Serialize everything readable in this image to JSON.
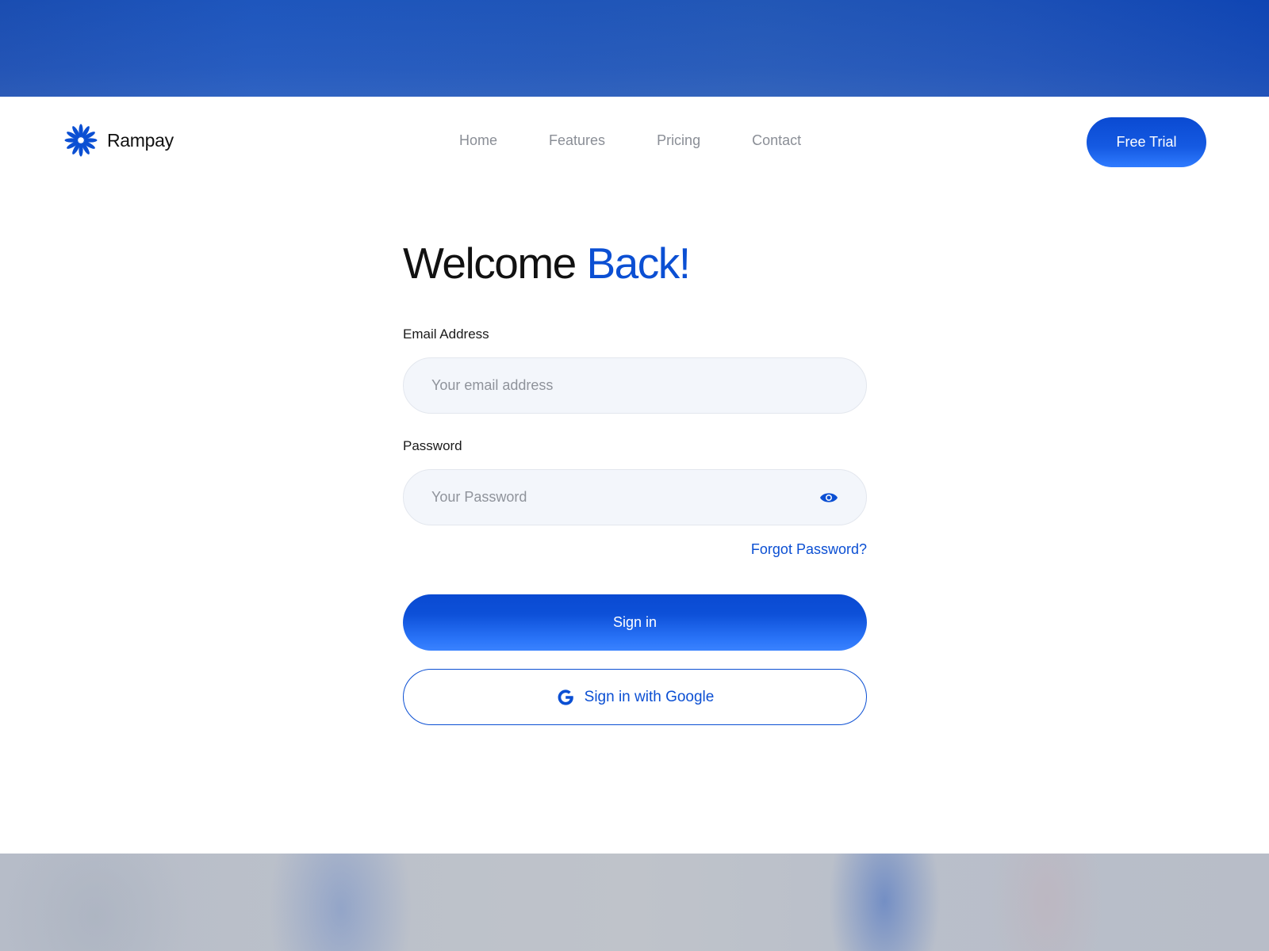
{
  "brand": {
    "name": "Rampay",
    "logo_icon": "asterisk-flower-icon",
    "color": "#0b4fd3"
  },
  "nav": {
    "items": [
      "Home",
      "Features",
      "Pricing",
      "Contact"
    ]
  },
  "header": {
    "cta_label": "Free Trial"
  },
  "form": {
    "title_main": "Welcome",
    "title_accent": "Back!",
    "email_label": "Email Address",
    "email_placeholder": "Your email address",
    "password_label": "Password",
    "password_placeholder": "Your Password",
    "password_toggle_icon": "eye-icon",
    "forgot_label": "Forgot Password?",
    "signin_label": "Sign in",
    "google_label": "Sign in with Google",
    "google_icon": "google-g-icon"
  },
  "colors": {
    "accent": "#0b4fd3",
    "input_bg": "#f3f6fb",
    "nav_text": "#8a8e96"
  }
}
